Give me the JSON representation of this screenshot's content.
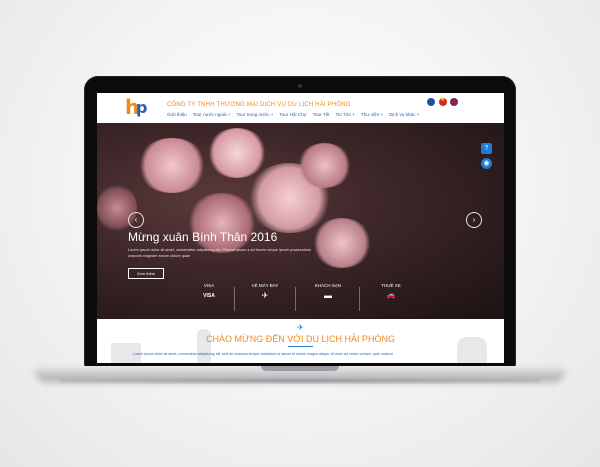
{
  "header": {
    "company_name": "CÔNG TY TNHH THƯƠNG MẠI DỊCH VỤ DU LỊCH HẢI PHÒNG"
  },
  "nav": {
    "items": [
      "Giới thiệu",
      "Tour nước ngoài +",
      "Tour trong nước +",
      "Tour Hội Chợ",
      "Tour Tết",
      "Tin Tức +",
      "Thư viện +",
      "Dịch vụ khác +"
    ]
  },
  "hero": {
    "title": "Mừng xuân Bính Thân 2016",
    "description": "Lorem ipsum dolor sit amet, consectetur adipisicing elit. Placeat ipsam a ad facere neque ipsum praesentium corporis magnam earum dolore quae",
    "more_label": "Xem thêm",
    "prev_arrow": "‹",
    "next_arrow": "›"
  },
  "services": [
    {
      "label": "VISA",
      "icon": "visa-card-icon",
      "glyph": "VISA"
    },
    {
      "label": "VÉ MÁY BAY",
      "icon": "plane-ticket-icon",
      "glyph": "✈"
    },
    {
      "label": "KHÁCH SẠN",
      "icon": "hotel-bed-icon",
      "glyph": "▬"
    },
    {
      "label": "THUÊ XE",
      "icon": "car-icon",
      "glyph": "🚗"
    }
  ],
  "side_icons": [
    {
      "icon": "help-icon",
      "glyph": "?"
    },
    {
      "icon": "eye-icon",
      "glyph": "◉"
    }
  ],
  "welcome": {
    "title": "CHÀO MỪNG ĐẾN VỚI DU LỊCH HẢI PHÒNG",
    "text": "Lorem ipsum dolor sit amet, consectetur adipisicing elit, sed do eiusmod tempor incididunt ut labore et dolore magna aliqua. Ut enim ad minim veniam, quis nostrud"
  },
  "colors": {
    "brand_orange": "#f08a1c",
    "brand_blue": "#2a5fb5",
    "accent_blue": "#1e7bd6"
  }
}
